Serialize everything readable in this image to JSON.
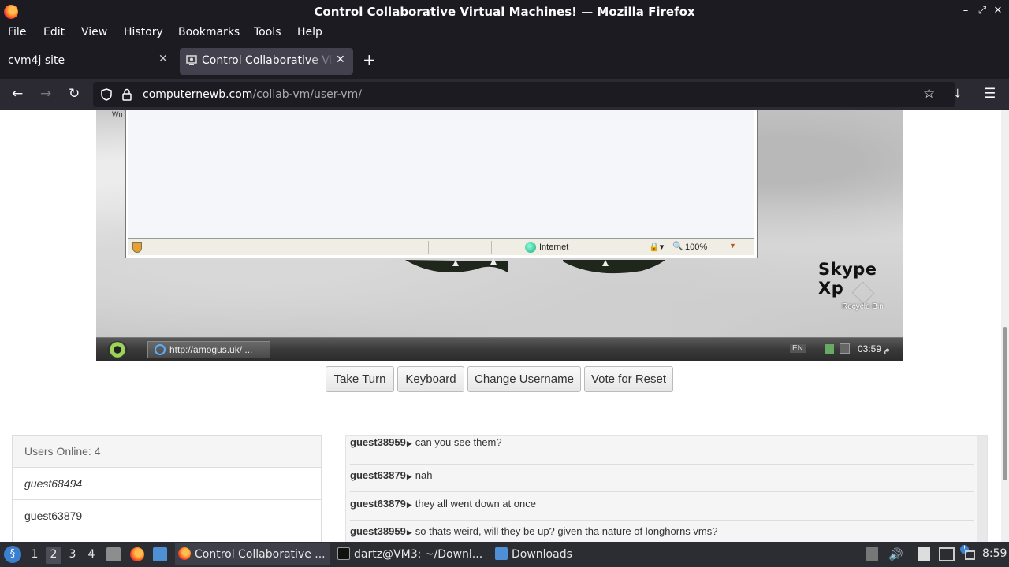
{
  "window": {
    "title": "Control Collaborative Virtual Machines! — Mozilla Firefox",
    "minimize": "–",
    "maximize": "⤢",
    "close": "✕"
  },
  "menu": [
    "File",
    "Edit",
    "View",
    "History",
    "Bookmarks",
    "Tools",
    "Help"
  ],
  "tabs": [
    {
      "label": "cvm4j site",
      "close": "✕"
    },
    {
      "label": "Control Collaborative Virtual Machines!",
      "close": "✕"
    }
  ],
  "new_tab": "+",
  "nav": {
    "back": "←",
    "forward": "→",
    "reload": "↻",
    "url_domain": "computernewb.com",
    "url_path": "/collab-vm/user-vm/",
    "bookmark": "☆",
    "downloads": "⤓",
    "menu": "☰"
  },
  "vm": {
    "corner_text": "Wn",
    "ie_status": {
      "zone": "Internet",
      "zoom": "100%"
    },
    "desktop_text": "Skype Xp",
    "recycle_bin": "Recycle Bin",
    "taskbar_button": "http://amogus.uk/ ...",
    "lang": "EN",
    "clock": "03:59 م"
  },
  "buttons": [
    "Take Turn",
    "Keyboard",
    "Change Username",
    "Vote for Reset"
  ],
  "users": {
    "header": "Users Online: 4",
    "list": [
      {
        "name": "guest68494",
        "self": true
      },
      {
        "name": "guest63879",
        "self": false
      }
    ]
  },
  "chat": [
    {
      "user": "guest38959",
      "text": "can you see them?"
    },
    {
      "user": "guest63879",
      "text": "nah"
    },
    {
      "user": "guest63879",
      "text": "they all went down at once"
    },
    {
      "user": "guest38959",
      "text": "so thats weird, will they be up? given tha nature of longhorns vms?"
    }
  ],
  "taskbar": {
    "workspaces": [
      "1",
      "2",
      "3",
      "4"
    ],
    "active_workspace": "2",
    "tasks": [
      {
        "label": "Control Collaborative ...",
        "icon": "firefox-icon",
        "active": true
      },
      {
        "label": "dartz@VM3: ~/Downl...",
        "icon": "terminal-icon",
        "active": false
      },
      {
        "label": "Downloads",
        "icon": "folder-icon",
        "active": false
      }
    ],
    "clock": "8:59"
  },
  "colors": {
    "firefox_dark": "#1c1b22",
    "toolbar": "#2b2a33",
    "taskbar": "#2b2d33"
  }
}
